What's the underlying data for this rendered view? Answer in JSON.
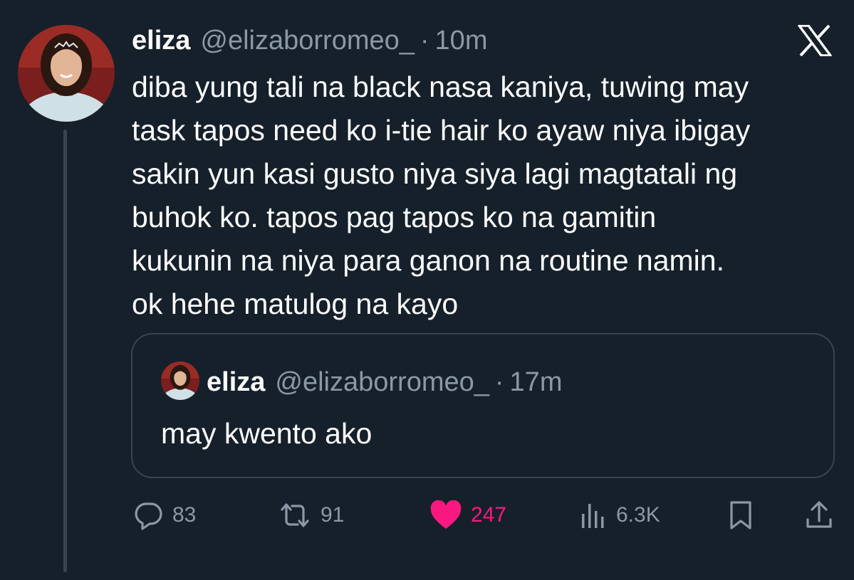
{
  "tweet": {
    "display_name": "eliza",
    "handle": "@elizaborromeo_",
    "separator": "·",
    "time": "10m",
    "text_lines": [
      "diba yung tali na black nasa kaniya, tuwing may",
      "task tapos need ko i-tie hair ko ayaw niya ibigay",
      "sakin yun kasi gusto niya siya lagi magtatali ng",
      "buhok ko. tapos pag tapos ko na gamitin",
      "kukunin na niya para ganon na routine namin.",
      "ok hehe matulog na kayo"
    ]
  },
  "quoted": {
    "display_name": "eliza",
    "handle": "@elizaborromeo_",
    "separator": "·",
    "time": "17m",
    "text": "may kwento ako"
  },
  "actions": {
    "replies": "83",
    "reposts": "91",
    "likes": "247",
    "views": "6.3K"
  },
  "icons": {
    "brand": "x-logo-icon",
    "reply": "reply-icon",
    "repost": "repost-icon",
    "like": "heart-icon",
    "views": "views-icon",
    "bookmark": "bookmark-icon",
    "share": "share-icon"
  },
  "colors": {
    "background": "#15202b",
    "text": "#ffffff",
    "muted": "#8b98a5",
    "border": "#38444d",
    "like": "#f91880"
  }
}
